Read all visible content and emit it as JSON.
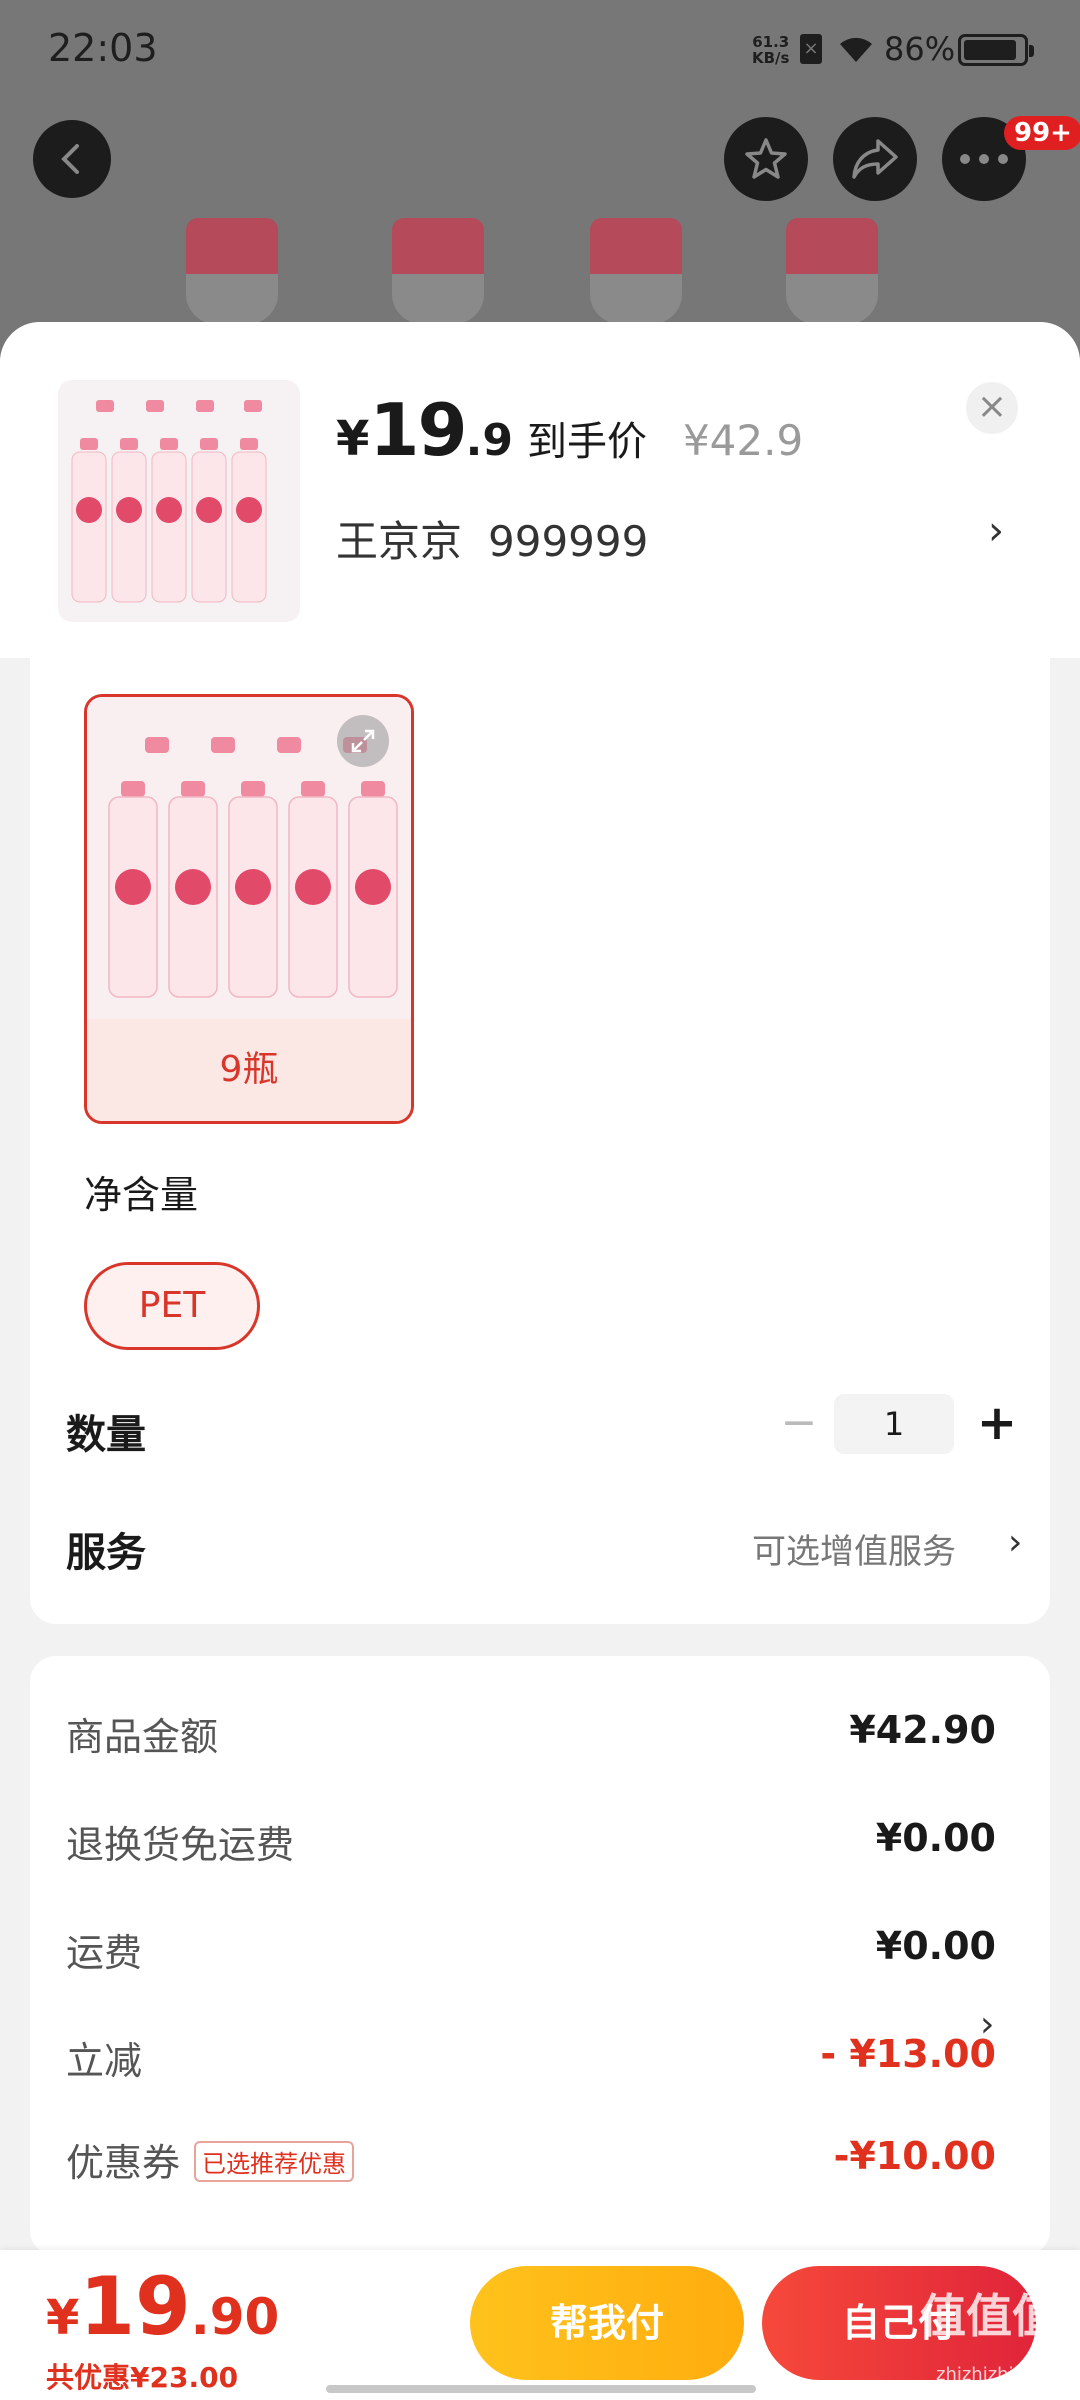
{
  "status_bar": {
    "time": "22:03",
    "net_speed_value": "61.3",
    "net_speed_unit": "KB/s",
    "battery": "86%"
  },
  "nav": {
    "badge": "99+",
    "icons": [
      "back-icon",
      "star-icon",
      "share-icon",
      "more-icon"
    ]
  },
  "product": {
    "price_yen": "¥",
    "price_int": "19",
    "price_dec": ".9",
    "price_tag": "到手价",
    "original_price": "¥42.9",
    "address_name": "王京京",
    "address_phone": "999999"
  },
  "options": {
    "variant_label": "9瓶",
    "net_content_label": "净含量",
    "packaging_option": "PET",
    "quantity_label": "数量",
    "quantity_value": "1",
    "service_label": "服务",
    "service_option": "可选增值服务"
  },
  "fees": [
    {
      "label": "商品金额",
      "value": "¥42.90",
      "highlight": false
    },
    {
      "label": "退换货免运费",
      "value": "¥0.00",
      "highlight": false
    },
    {
      "label": "运费",
      "value": "¥0.00",
      "highlight": false
    },
    {
      "label": "立减",
      "value": "- ¥13.00",
      "highlight": true
    },
    {
      "label": "优惠券",
      "value": "-¥10.00",
      "highlight": true,
      "tag": "已选推荐优惠"
    }
  ],
  "bottom": {
    "total_yen": "¥",
    "total_int": "19",
    "total_dec": ".90",
    "saving": "共优惠¥23.00",
    "help_pay": "帮我付",
    "self_pay": "自己付"
  },
  "watermark": {
    "text": "值值值",
    "sub": "zhizhizhi.com"
  },
  "colors": {
    "accent": "#e0301e",
    "help_pay": "#ffb916",
    "self_pay": "#ea3339"
  }
}
